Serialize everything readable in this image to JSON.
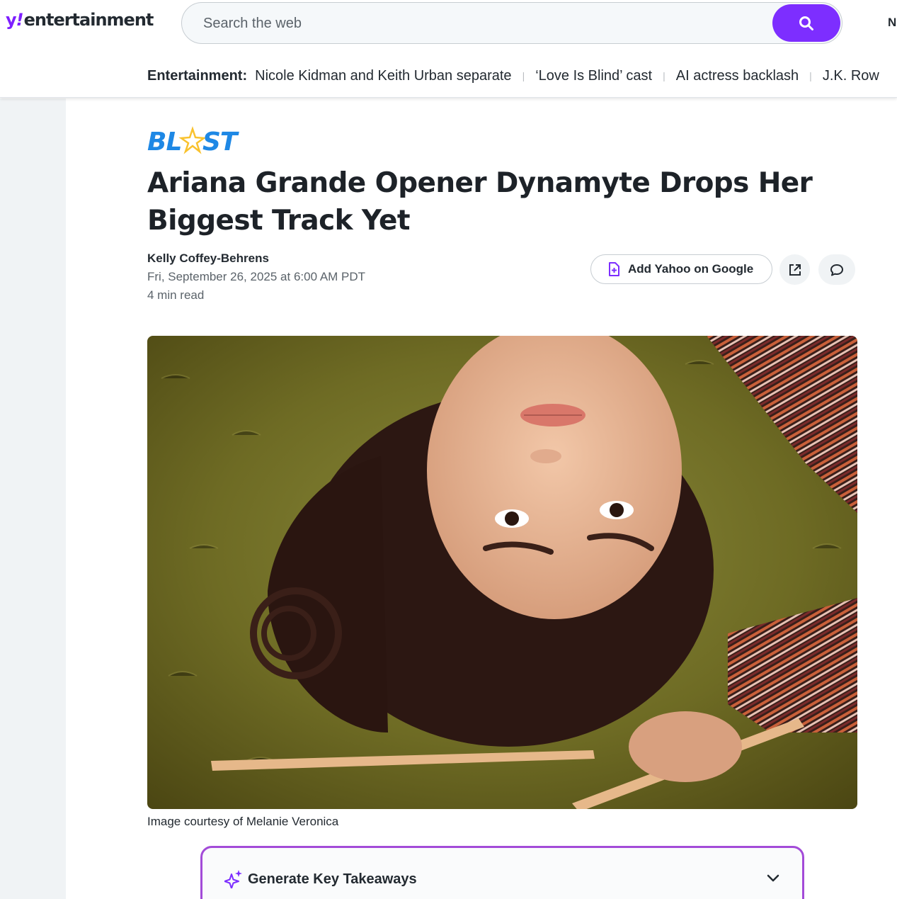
{
  "header": {
    "logo_prefix": "y",
    "logo_bang": "!",
    "logo_section": "entertainment",
    "search_placeholder": "Search the web",
    "edge_letter": "N"
  },
  "trending": {
    "label": "Entertainment:",
    "items": [
      "Nicole Kidman and Keith Urban separate",
      "‘Love Is Blind’ cast",
      "AI actress backlash",
      "J.K. Row"
    ]
  },
  "article": {
    "brand": "BLAST",
    "title": "Ariana Grande Opener Dynamyte Drops Her Biggest Track Yet",
    "author": "Kelly Coffey-Behrens",
    "date": "Fri, September 26, 2025 at 6:00 AM PDT",
    "read_time": "4 min read",
    "add_yahoo_label": "Add Yahoo on Google",
    "image_caption": "Image courtesy of Melanie Veronica"
  },
  "takeaways": {
    "label": "Generate Key Takeaways"
  },
  "colors": {
    "brand_purple": "#7d2eff",
    "takeaways_border": "#a34bd8",
    "blast_blue": "#1e88e5",
    "blast_star": "#f9c22e"
  }
}
